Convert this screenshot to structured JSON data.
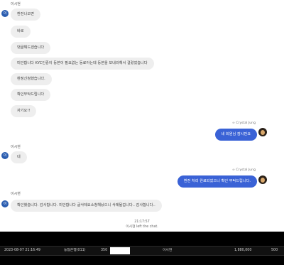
{
  "incoming_sender": "이시현",
  "incoming_avatar": "이",
  "messages_in_1": [
    "환전나오면",
    "바로",
    "댓글해드겠습니다",
    "미안합니다 KYC인증이 등본이 필요없는 동료아는데 등본을 보내라해서 걸렸었습니다",
    "환정신청했습니다.",
    "확인부탁드립니다",
    "자기요!!"
  ],
  "outgoing_1": {
    "sender": "Crystal Jung",
    "text": "네 회원님 잠시만요"
  },
  "messages_in_2": [
    "네"
  ],
  "outgoing_2": {
    "sender": "Crystal Jung",
    "text": "환전 처리 완료되었으니 확인 부탁드립니다."
  },
  "messages_in_3": [
    "확인했습니다. 감사합니다. 미안합니다 글삭제요소청해놨으니 삭제될겁니다.. 감사합니다.."
  ],
  "system": {
    "time": "21:17:57",
    "left_text": "이시현 left the chat."
  },
  "transaction": {
    "datetime": "2023-08-07 21:16:49",
    "bank": "농협은행(011)",
    "account_prefix": "350",
    "name": "이시현",
    "amount": "1,880,000",
    "fee": "500"
  },
  "colors": {
    "outgoing_bubble": "#3a62d6",
    "incoming_bubble": "#eeeeee",
    "avatar": "#2a5db0",
    "footer": "#000000"
  }
}
